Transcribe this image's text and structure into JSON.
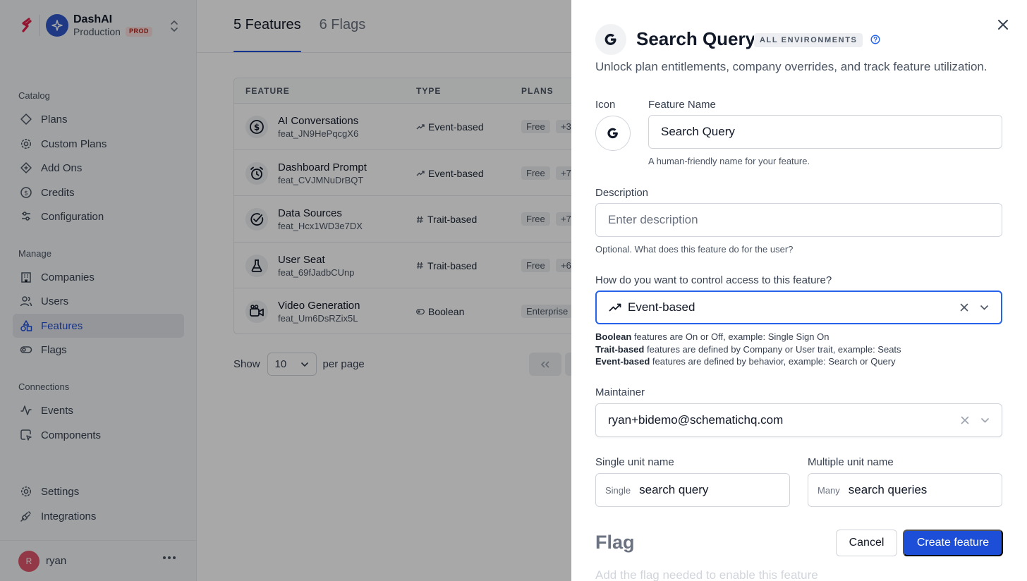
{
  "sidebar": {
    "app_name": "DashAI",
    "env_name": "Production",
    "env_badge": "PROD",
    "sections": {
      "catalog": "Catalog",
      "manage": "Manage",
      "connections": "Connections"
    },
    "items": {
      "plans": "Plans",
      "custom_plans": "Custom Plans",
      "add_ons": "Add Ons",
      "credits": "Credits",
      "configuration": "Configuration",
      "companies": "Companies",
      "users": "Users",
      "features": "Features",
      "flags": "Flags",
      "events": "Events",
      "components": "Components",
      "settings": "Settings",
      "integrations": "Integrations"
    },
    "active_item": "features",
    "user": {
      "initial": "R",
      "name": "ryan"
    }
  },
  "main": {
    "tabs": [
      {
        "label": "5 Features",
        "active": true
      },
      {
        "label": "6 Flags",
        "active": false
      }
    ],
    "table": {
      "columns": [
        "FEATURE",
        "TYPE",
        "PLANS"
      ],
      "rows": [
        {
          "name": "AI Conversations",
          "key": "feat_JN9HePqcgX6",
          "type": "Event-based",
          "plan": "Free",
          "more": "+3",
          "icon": "dollar-circle-icon"
        },
        {
          "name": "Dashboard Prompt",
          "key": "feat_CVJMNuDrBQT",
          "type": "Event-based",
          "plan": "Free",
          "more": "+7",
          "icon": "alarm-clock-icon"
        },
        {
          "name": "Data Sources",
          "key": "feat_Hcx1WD3e7DX",
          "type": "Trait-based",
          "plan": "Free",
          "more": "+7",
          "icon": "check-circle-icon"
        },
        {
          "name": "User Seat",
          "key": "feat_69fJadbCUnp",
          "type": "Trait-based",
          "plan": "Free",
          "more": "+6",
          "icon": "flask-icon"
        },
        {
          "name": "Video Generation",
          "key": "feat_Um6DsRZix5L",
          "type": "Boolean",
          "plan": "Enterprise",
          "more": "",
          "icon": "video-camera-icon"
        }
      ]
    },
    "pager": {
      "show_label": "Show",
      "per_page_value": "10",
      "per_page_label": "per page"
    }
  },
  "drawer": {
    "title": "Search Query",
    "env_badge": "ALL ENVIRONMENTS",
    "subtitle": "Unlock plan entitlements, company overrides, and track feature utilization.",
    "icon_label": "Icon",
    "name_label": "Feature Name",
    "name_value": "Search Query",
    "name_hint": "A human-friendly name for your feature.",
    "description_label": "Description",
    "description_placeholder": "Enter description",
    "description_hint": "Optional. What does this feature do for the user?",
    "access_label": "How do you want to control access to this feature?",
    "access_value": "Event-based",
    "legend": [
      {
        "term": "Boolean",
        "text": " features are On or Off, example: Single Sign On"
      },
      {
        "term": "Trait-based",
        "text": " features are defined by Company or User trait, example: Seats"
      },
      {
        "term": "Event-based",
        "text": " features are defined by behavior, example: Search or Query"
      }
    ],
    "maintainer_label": "Maintainer",
    "maintainer_value": "ryan+bidemo@schematichq.com",
    "single_unit_label": "Single unit name",
    "single_prefix": "Single",
    "single_value": "search query",
    "multiple_unit_label": "Multiple unit name",
    "multiple_prefix": "Many",
    "multiple_value": "search queries",
    "flag_title": "Flag",
    "flag_hint": "Add the flag needed to enable this feature",
    "cancel_label": "Cancel",
    "create_label": "Create feature"
  },
  "colors": {
    "accent": "#1d4ed8",
    "overlay": "rgba(0,0,0,0.34)"
  }
}
